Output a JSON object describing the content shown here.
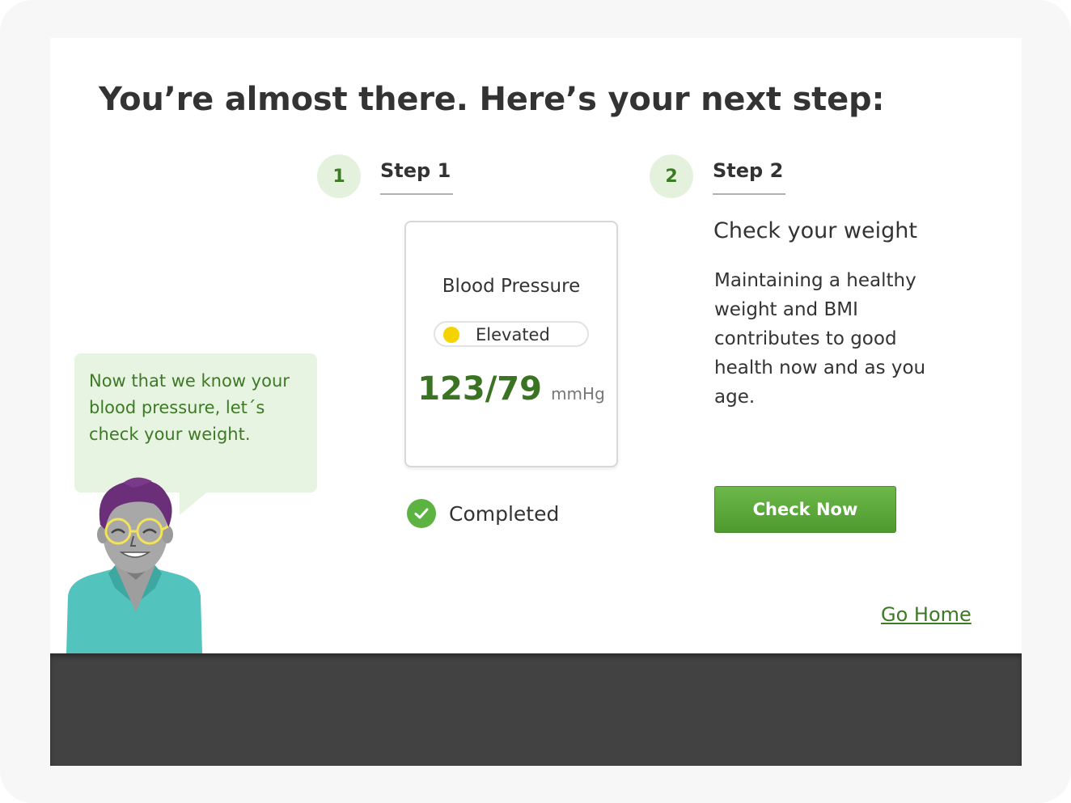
{
  "headline": "You’re almost there. Here’s your next step:",
  "steps": [
    {
      "number": "1",
      "label": "Step 1"
    },
    {
      "number": "2",
      "label": "Step 2"
    }
  ],
  "card": {
    "title": "Blood Pressure",
    "status": "Elevated",
    "status_color": "#f5d300",
    "value": "123/79",
    "unit": "mmHg"
  },
  "completed_label": "Completed",
  "step2": {
    "title": "Check your weight",
    "description": "Maintaining a healthy weight and BMI contributes to good health now and as you age.",
    "button": "Check Now"
  },
  "go_home": "Go Home",
  "bubble": "Now that we know your blood pressure, let´s check your weight.",
  "colors": {
    "accent_green": "#3d7a25",
    "button_green": "#5aa83a",
    "bottom_bar": "#424242"
  },
  "icons": {
    "completed": "checkmark-circle-icon",
    "avatar": "person-avatar-illustration"
  }
}
